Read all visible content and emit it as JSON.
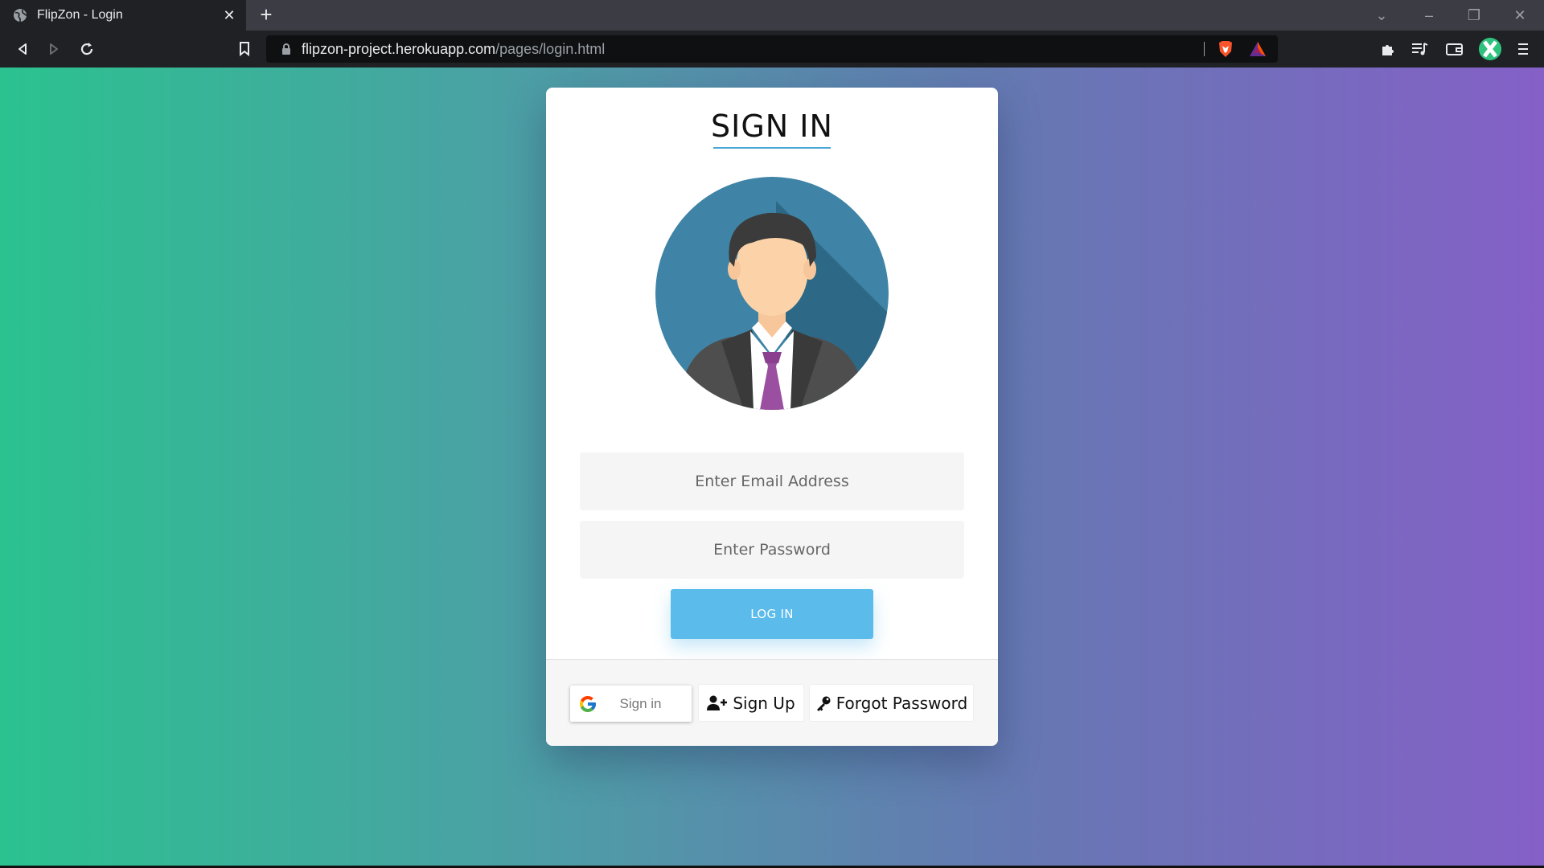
{
  "browser": {
    "tab_title": "FlipZon - Login",
    "url_host": "flipzon-project.herokuapp.com",
    "url_path": "/pages/login.html"
  },
  "login": {
    "title": "SIGN IN",
    "email_placeholder": "Enter Email Address",
    "password_placeholder": "Enter Password",
    "login_button": "LOG IN",
    "google_signin_label": "Sign in",
    "signup_label": "Sign Up",
    "forgot_label": "Forgot Password"
  },
  "colors": {
    "bg_gradient_start": "#2bc28f",
    "bg_gradient_end": "#8460c7",
    "login_button": "#5bbbeb",
    "avatar_circle": "#3f84a6",
    "tie": "#9b4fa0"
  },
  "icons": [
    "globe-icon",
    "close-icon",
    "plus-icon",
    "back-icon",
    "forward-icon",
    "reload-icon",
    "bookmark-icon",
    "lock-icon",
    "brave-shield-icon",
    "bat-rewards-icon",
    "extensions-icon",
    "media-queue-icon",
    "wallet-icon",
    "profile-avatar-icon",
    "menu-icon",
    "google-g-icon",
    "user-plus-icon",
    "key-icon"
  ]
}
